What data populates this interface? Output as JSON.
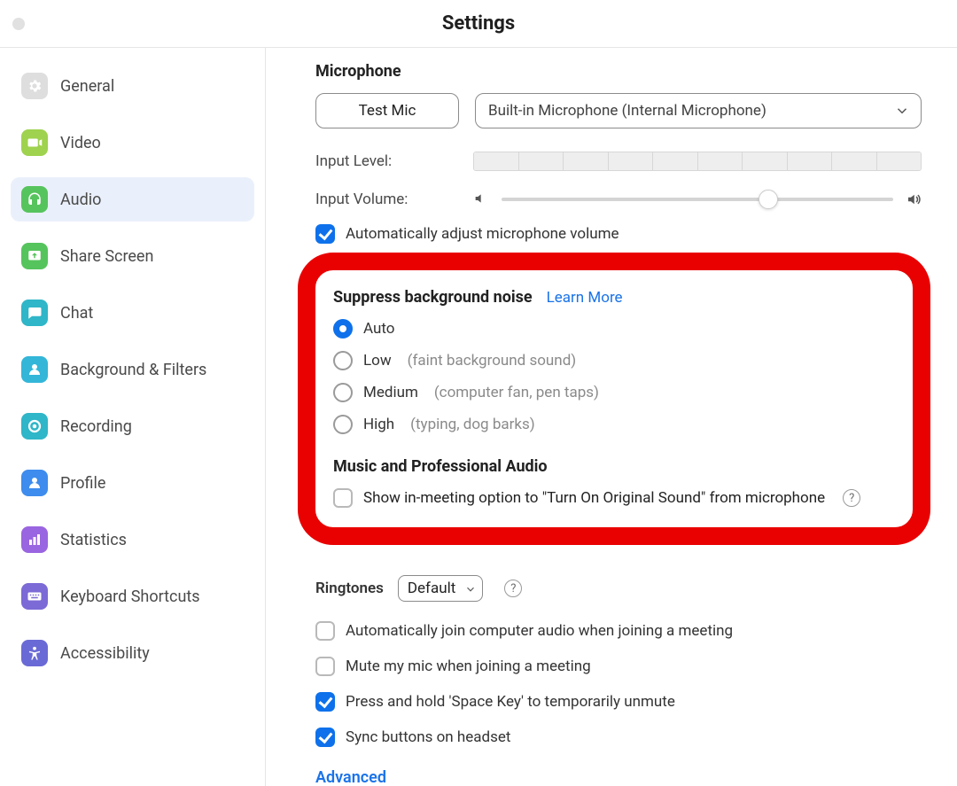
{
  "window": {
    "title": "Settings"
  },
  "sidebar": {
    "items": [
      {
        "label": "General"
      },
      {
        "label": "Video"
      },
      {
        "label": "Audio"
      },
      {
        "label": "Share Screen"
      },
      {
        "label": "Chat"
      },
      {
        "label": "Background & Filters"
      },
      {
        "label": "Recording"
      },
      {
        "label": "Profile"
      },
      {
        "label": "Statistics"
      },
      {
        "label": "Keyboard Shortcuts"
      },
      {
        "label": "Accessibility"
      }
    ],
    "active_index": 2
  },
  "main": {
    "microphone": {
      "title": "Microphone",
      "test_mic_label": "Test Mic",
      "selected_device": "Built-in Microphone (Internal Microphone)",
      "input_level_label": "Input Level:",
      "input_volume_label": "Input Volume:",
      "input_volume_percent": 68,
      "auto_adjust_label": "Automatically adjust microphone volume",
      "auto_adjust_checked": true
    },
    "suppress": {
      "title": "Suppress background noise",
      "learn_more": "Learn More",
      "options": [
        {
          "label": "Auto",
          "hint": ""
        },
        {
          "label": "Low",
          "hint": "(faint background sound)"
        },
        {
          "label": "Medium",
          "hint": "(computer fan, pen taps)"
        },
        {
          "label": "High",
          "hint": "(typing, dog barks)"
        }
      ],
      "selected_index": 0
    },
    "music": {
      "title": "Music and Professional Audio",
      "original_sound_label": "Show in-meeting option to \"Turn On Original Sound\" from microphone",
      "original_sound_checked": false
    },
    "ringtones": {
      "label": "Ringtones",
      "value": "Default"
    },
    "options": {
      "auto_join_audio_label": "Automatically join computer audio when joining a meeting",
      "auto_join_audio_checked": false,
      "mute_on_join_label": "Mute my mic when joining a meeting",
      "mute_on_join_checked": false,
      "space_unmute_label": "Press and hold 'Space Key' to temporarily unmute",
      "space_unmute_checked": true,
      "sync_headset_label": "Sync buttons on headset",
      "sync_headset_checked": true
    },
    "advanced_label": "Advanced"
  },
  "icon_colors": {
    "general": "#dedede",
    "video": "#9fd24e",
    "audio": "#56c45d",
    "share_screen": "#56c45d",
    "chat": "#2fb6c8",
    "bg_filters": "#33b6d8",
    "recording": "#2fb6c8",
    "profile": "#3e8ced",
    "statistics": "#9a65e0",
    "shortcuts": "#7c6ad6",
    "accessibility": "#6a6ad6"
  }
}
